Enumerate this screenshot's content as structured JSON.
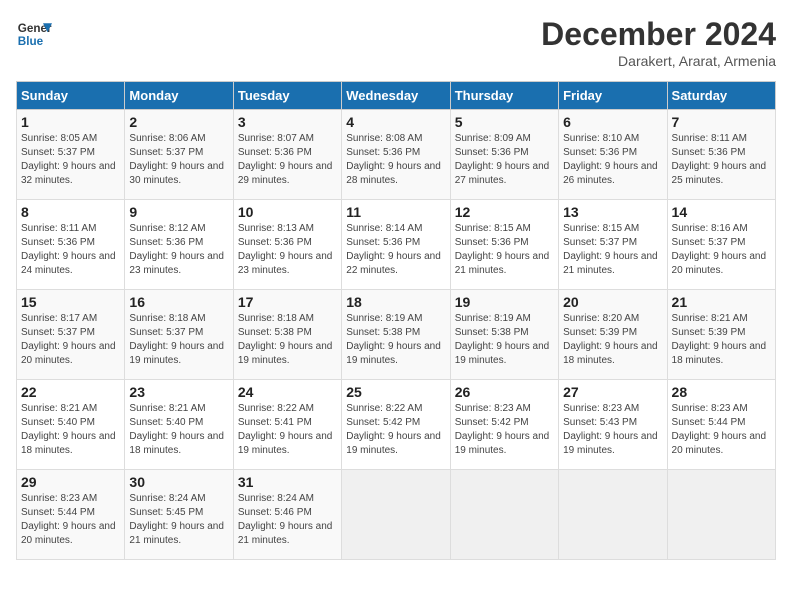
{
  "logo": {
    "line1": "General",
    "line2": "Blue"
  },
  "title": "December 2024",
  "subtitle": "Darakert, Ararat, Armenia",
  "days_of_week": [
    "Sunday",
    "Monday",
    "Tuesday",
    "Wednesday",
    "Thursday",
    "Friday",
    "Saturday"
  ],
  "weeks": [
    [
      {
        "day": "1",
        "sunrise": "Sunrise: 8:05 AM",
        "sunset": "Sunset: 5:37 PM",
        "daylight": "Daylight: 9 hours and 32 minutes."
      },
      {
        "day": "2",
        "sunrise": "Sunrise: 8:06 AM",
        "sunset": "Sunset: 5:37 PM",
        "daylight": "Daylight: 9 hours and 30 minutes."
      },
      {
        "day": "3",
        "sunrise": "Sunrise: 8:07 AM",
        "sunset": "Sunset: 5:36 PM",
        "daylight": "Daylight: 9 hours and 29 minutes."
      },
      {
        "day": "4",
        "sunrise": "Sunrise: 8:08 AM",
        "sunset": "Sunset: 5:36 PM",
        "daylight": "Daylight: 9 hours and 28 minutes."
      },
      {
        "day": "5",
        "sunrise": "Sunrise: 8:09 AM",
        "sunset": "Sunset: 5:36 PM",
        "daylight": "Daylight: 9 hours and 27 minutes."
      },
      {
        "day": "6",
        "sunrise": "Sunrise: 8:10 AM",
        "sunset": "Sunset: 5:36 PM",
        "daylight": "Daylight: 9 hours and 26 minutes."
      },
      {
        "day": "7",
        "sunrise": "Sunrise: 8:11 AM",
        "sunset": "Sunset: 5:36 PM",
        "daylight": "Daylight: 9 hours and 25 minutes."
      }
    ],
    [
      {
        "day": "8",
        "sunrise": "Sunrise: 8:11 AM",
        "sunset": "Sunset: 5:36 PM",
        "daylight": "Daylight: 9 hours and 24 minutes."
      },
      {
        "day": "9",
        "sunrise": "Sunrise: 8:12 AM",
        "sunset": "Sunset: 5:36 PM",
        "daylight": "Daylight: 9 hours and 23 minutes."
      },
      {
        "day": "10",
        "sunrise": "Sunrise: 8:13 AM",
        "sunset": "Sunset: 5:36 PM",
        "daylight": "Daylight: 9 hours and 23 minutes."
      },
      {
        "day": "11",
        "sunrise": "Sunrise: 8:14 AM",
        "sunset": "Sunset: 5:36 PM",
        "daylight": "Daylight: 9 hours and 22 minutes."
      },
      {
        "day": "12",
        "sunrise": "Sunrise: 8:15 AM",
        "sunset": "Sunset: 5:36 PM",
        "daylight": "Daylight: 9 hours and 21 minutes."
      },
      {
        "day": "13",
        "sunrise": "Sunrise: 8:15 AM",
        "sunset": "Sunset: 5:37 PM",
        "daylight": "Daylight: 9 hours and 21 minutes."
      },
      {
        "day": "14",
        "sunrise": "Sunrise: 8:16 AM",
        "sunset": "Sunset: 5:37 PM",
        "daylight": "Daylight: 9 hours and 20 minutes."
      }
    ],
    [
      {
        "day": "15",
        "sunrise": "Sunrise: 8:17 AM",
        "sunset": "Sunset: 5:37 PM",
        "daylight": "Daylight: 9 hours and 20 minutes."
      },
      {
        "day": "16",
        "sunrise": "Sunrise: 8:18 AM",
        "sunset": "Sunset: 5:37 PM",
        "daylight": "Daylight: 9 hours and 19 minutes."
      },
      {
        "day": "17",
        "sunrise": "Sunrise: 8:18 AM",
        "sunset": "Sunset: 5:38 PM",
        "daylight": "Daylight: 9 hours and 19 minutes."
      },
      {
        "day": "18",
        "sunrise": "Sunrise: 8:19 AM",
        "sunset": "Sunset: 5:38 PM",
        "daylight": "Daylight: 9 hours and 19 minutes."
      },
      {
        "day": "19",
        "sunrise": "Sunrise: 8:19 AM",
        "sunset": "Sunset: 5:38 PM",
        "daylight": "Daylight: 9 hours and 19 minutes."
      },
      {
        "day": "20",
        "sunrise": "Sunrise: 8:20 AM",
        "sunset": "Sunset: 5:39 PM",
        "daylight": "Daylight: 9 hours and 18 minutes."
      },
      {
        "day": "21",
        "sunrise": "Sunrise: 8:21 AM",
        "sunset": "Sunset: 5:39 PM",
        "daylight": "Daylight: 9 hours and 18 minutes."
      }
    ],
    [
      {
        "day": "22",
        "sunrise": "Sunrise: 8:21 AM",
        "sunset": "Sunset: 5:40 PM",
        "daylight": "Daylight: 9 hours and 18 minutes."
      },
      {
        "day": "23",
        "sunrise": "Sunrise: 8:21 AM",
        "sunset": "Sunset: 5:40 PM",
        "daylight": "Daylight: 9 hours and 18 minutes."
      },
      {
        "day": "24",
        "sunrise": "Sunrise: 8:22 AM",
        "sunset": "Sunset: 5:41 PM",
        "daylight": "Daylight: 9 hours and 19 minutes."
      },
      {
        "day": "25",
        "sunrise": "Sunrise: 8:22 AM",
        "sunset": "Sunset: 5:42 PM",
        "daylight": "Daylight: 9 hours and 19 minutes."
      },
      {
        "day": "26",
        "sunrise": "Sunrise: 8:23 AM",
        "sunset": "Sunset: 5:42 PM",
        "daylight": "Daylight: 9 hours and 19 minutes."
      },
      {
        "day": "27",
        "sunrise": "Sunrise: 8:23 AM",
        "sunset": "Sunset: 5:43 PM",
        "daylight": "Daylight: 9 hours and 19 minutes."
      },
      {
        "day": "28",
        "sunrise": "Sunrise: 8:23 AM",
        "sunset": "Sunset: 5:44 PM",
        "daylight": "Daylight: 9 hours and 20 minutes."
      }
    ],
    [
      {
        "day": "29",
        "sunrise": "Sunrise: 8:23 AM",
        "sunset": "Sunset: 5:44 PM",
        "daylight": "Daylight: 9 hours and 20 minutes."
      },
      {
        "day": "30",
        "sunrise": "Sunrise: 8:24 AM",
        "sunset": "Sunset: 5:45 PM",
        "daylight": "Daylight: 9 hours and 21 minutes."
      },
      {
        "day": "31",
        "sunrise": "Sunrise: 8:24 AM",
        "sunset": "Sunset: 5:46 PM",
        "daylight": "Daylight: 9 hours and 21 minutes."
      },
      null,
      null,
      null,
      null
    ]
  ]
}
